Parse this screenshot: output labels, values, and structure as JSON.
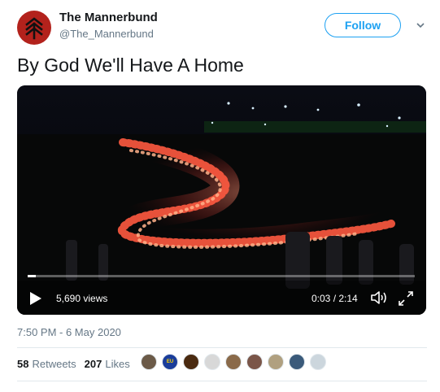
{
  "author": {
    "name": "The Mannerbund",
    "handle": "@The_Mannerbund"
  },
  "follow_label": "Follow",
  "tweet_text": "By God We'll Have A Home",
  "video": {
    "views": "5,690 views",
    "timecode": "0:03 / 2:14",
    "progress": 0.022
  },
  "timestamp": "7:50 PM - 6 May 2020",
  "stats": {
    "retweets_count": "58",
    "retweets_label": "Retweets",
    "likes_count": "207",
    "likes_label": "Likes"
  },
  "likers": [
    {
      "icon": "avatar-1",
      "color": "#6b5a48"
    },
    {
      "icon": "eu-flag-icon",
      "color": "#1a3d9a",
      "label": "EU"
    },
    {
      "icon": "avatar-3",
      "color": "#4a2a10"
    },
    {
      "icon": "avatar-4",
      "color": "#d8d8d8"
    },
    {
      "icon": "avatar-5",
      "color": "#8a6a4a"
    },
    {
      "icon": "avatar-6",
      "color": "#7a5548"
    },
    {
      "icon": "avatar-7",
      "color": "#b0a080"
    },
    {
      "icon": "avatar-8",
      "color": "#3a5a7a"
    },
    {
      "icon": "default-avatar-icon",
      "color": "#ccd6dd"
    }
  ],
  "colors": {
    "brand_red": "#b3221c",
    "accent_blue": "#1da1f2",
    "muted_gray": "#657786"
  }
}
